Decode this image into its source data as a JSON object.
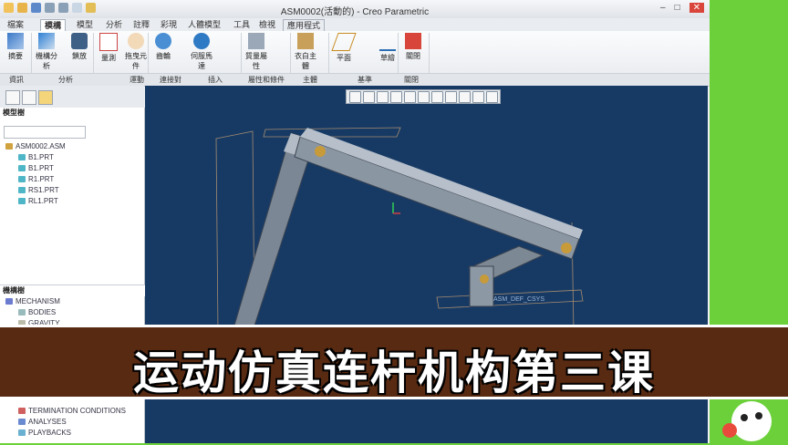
{
  "window": {
    "title": "ASM0002(活動的) - Creo Parametric"
  },
  "menus": [
    "檔案",
    "模構",
    "模型",
    "分析",
    "註釋",
    "彩現",
    "人體模型",
    "工具",
    "檢視",
    "應用程式"
  ],
  "ribbon_tools": [
    {
      "label": "摘要"
    },
    {
      "label": "機構分析"
    },
    {
      "label": "鎖放"
    },
    {
      "label": "量測"
    },
    {
      "label": "拖曳元件"
    },
    {
      "label": "齒輪"
    },
    {
      "label": "伺服馬達"
    },
    {
      "label": "質量屬性"
    },
    {
      "label": "衣白主體"
    },
    {
      "label": "平面"
    },
    {
      "label": "草繪"
    },
    {
      "label": "關閉"
    }
  ],
  "ribbon_groups": [
    "資訊",
    "分析",
    "運動",
    "連接對",
    "插入",
    "屬性和條件",
    "主體",
    "基準",
    "關閉"
  ],
  "model_tree": {
    "header": "模型樹",
    "items": [
      "ASM0002.ASM",
      "B1.PRT",
      "B1.PRT",
      "R1.PRT",
      "RS1.PRT",
      "RL1.PRT"
    ]
  },
  "mechanism_tree": {
    "header": "機構樹",
    "items": [
      "MECHANISM",
      "BODIES",
      "GRAVITY"
    ],
    "bottom_items": [
      "TERMINATION CONDITIONS",
      "ANALYSES",
      "PLAYBACKS"
    ]
  },
  "viewport": {
    "csys_label": "ASM_DEF_CSYS",
    "bg": "#173a65"
  },
  "banner": {
    "text": "运动仿真连杆机构第三课"
  },
  "colors": {
    "banner_bg": "#582a12",
    "side": "#6bd03a"
  }
}
